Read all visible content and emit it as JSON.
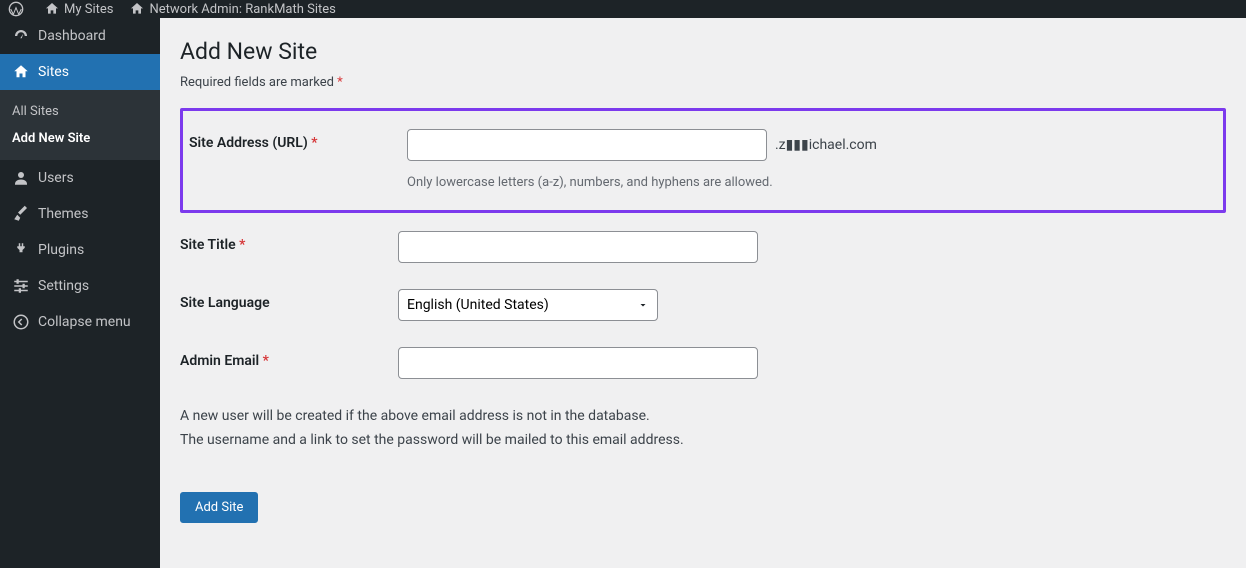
{
  "topbar": {
    "my_sites": "My Sites",
    "network_admin": "Network Admin: RankMath Sites"
  },
  "sidebar": {
    "dashboard": "Dashboard",
    "sites": "Sites",
    "sites_sub": {
      "all_sites": "All Sites",
      "add_new_site": "Add New Site"
    },
    "users": "Users",
    "themes": "Themes",
    "plugins": "Plugins",
    "settings": "Settings",
    "collapse": "Collapse menu"
  },
  "main": {
    "title": "Add New Site",
    "required_note": "Required fields are marked ",
    "required_star": "*",
    "fields": {
      "site_address": {
        "label": "Site Address (URL) ",
        "suffix": ".z▮▮▮ichael.com",
        "hint": "Only lowercase letters (a-z), numbers, and hyphens are allowed."
      },
      "site_title": {
        "label": "Site Title "
      },
      "site_language": {
        "label": "Site Language",
        "value": "English (United States)"
      },
      "admin_email": {
        "label": "Admin Email "
      }
    },
    "info_line1": "A new user will be created if the above email address is not in the database.",
    "info_line2": "The username and a link to set the password will be mailed to this email address.",
    "submit": "Add Site"
  }
}
